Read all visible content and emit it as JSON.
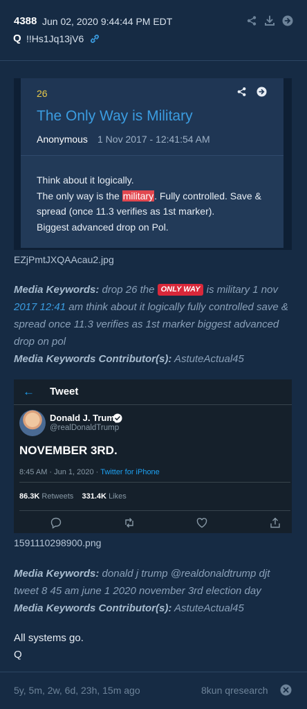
{
  "header": {
    "post_number": "4388",
    "date": "Jun 02, 2020 9:44:44 PM EDT",
    "poster": "Q",
    "tripcode": "!!Hs1Jq13jV6"
  },
  "quote": {
    "number": "26",
    "title": "The Only Way is Military",
    "author": "Anonymous",
    "date": "1 Nov 2017 - 12:41:54 AM",
    "line1": "Think about it logically.",
    "line2_pre": "The only way is the ",
    "line2_hl": "military",
    "line2_post": ". Fully controlled. Save &",
    "line3": "spread (once 11.3 verifies as 1st marker).",
    "line4": "Biggest advanced drop on Pol."
  },
  "file1": "EZjPmtJXQAAcau2.jpg",
  "media1": {
    "label": "Media Keywords:",
    "pre": " drop 26 the ",
    "badge": "ONLY WAY",
    "mid": " is military 1 nov",
    "link": "2017 12:41",
    "post": " am think about it logically fully controlled save & spread once 11.3 verifies as 1st marker biggest advanced drop on pol",
    "contrib_label": "Media Keywords Contributor(s):",
    "contrib": " AstuteActual45"
  },
  "tweet": {
    "header": "Tweet",
    "name": "Donald J. Trump",
    "handle": "@realDonaldTrump",
    "text": "NOVEMBER 3RD.",
    "time": "8:45 AM · Jun 1, 2020 · ",
    "source": "Twitter for iPhone",
    "retweets": "86.3K",
    "retweets_label": "Retweets",
    "likes": "331.4K",
    "likes_label": "Likes"
  },
  "file2": "1591110298900.png",
  "media2": {
    "label": "Media Keywords:",
    "text": " donald j trump @realdonaldtrump djt tweet 8 45 am june 1 2020 november 3rd election day",
    "contrib_label": "Media Keywords Contributor(s):",
    "contrib": " AstuteActual45"
  },
  "message": {
    "line1": "All systems go.",
    "line2": "Q"
  },
  "footer": {
    "ago": "5y, 5m, 2w, 6d, 23h, 15m ago",
    "board": "8kun qresearch"
  },
  "colors": {
    "background": "#162b44",
    "accent": "#3b9ce0",
    "highlight": "#e2474f",
    "tweet_bg": "#15202b"
  }
}
